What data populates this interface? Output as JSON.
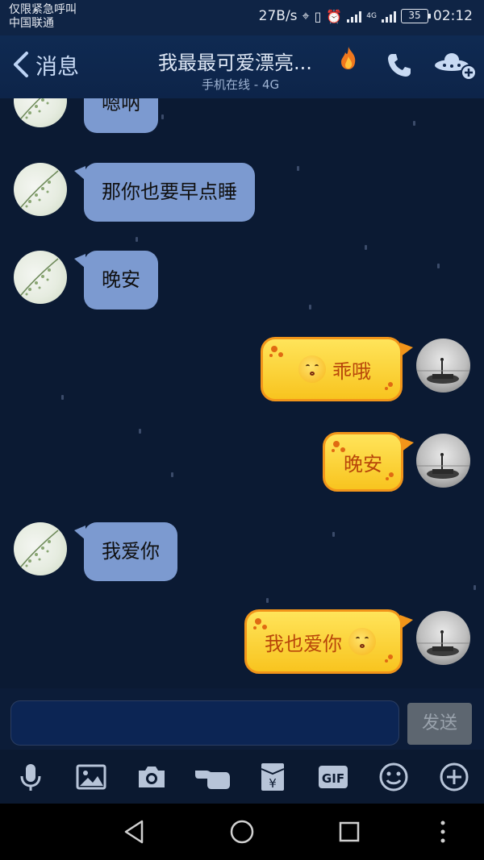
{
  "status_bar": {
    "carrier_line1": "仅限紧急呼叫",
    "carrier_line2": "中国联通",
    "speed": "27B/s",
    "network": "4G",
    "battery": "35",
    "time": "02:12"
  },
  "header": {
    "back_label": "消息",
    "title": "我最最可爱漂亮...",
    "subtitle": "手机在线 - 4G"
  },
  "messages": [
    {
      "side": "left",
      "text": "嗯呐"
    },
    {
      "side": "left",
      "text": "那你也要早点睡"
    },
    {
      "side": "left",
      "text": "晚安"
    },
    {
      "side": "right",
      "text": "乖哦",
      "emoji": "kissing-face-emoji"
    },
    {
      "side": "right",
      "text": "晚安"
    },
    {
      "side": "left",
      "text": "我爱你"
    },
    {
      "side": "right",
      "text": "我也爱你",
      "emoji": "kissing-smiling-eyes-emoji"
    }
  ],
  "input": {
    "value": "",
    "send_label": "发送"
  },
  "toolbar": {
    "gif_label": "GIF",
    "items": [
      "microphone-icon",
      "image-icon",
      "camera-icon",
      "poke-hand-icon",
      "red-packet-icon",
      "gif-icon",
      "emoji-icon",
      "plus-icon"
    ]
  },
  "colors": {
    "background": "#0b1a33",
    "left_bubble": "#7c9ad0",
    "right_bubble": "#f8c41f",
    "right_bubble_border": "#f2951a"
  }
}
